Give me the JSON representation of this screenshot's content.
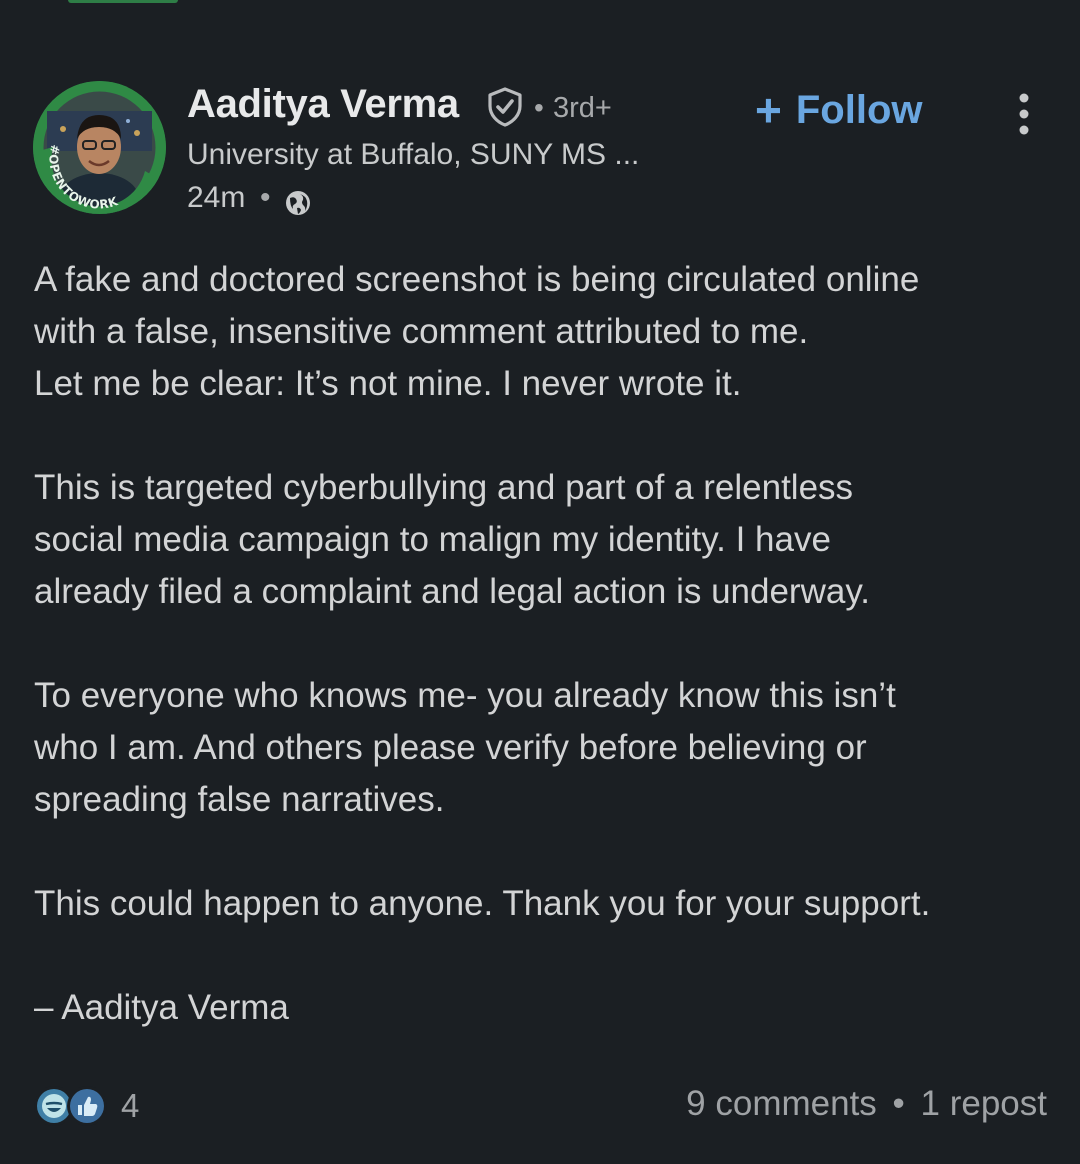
{
  "post": {
    "author": {
      "name": "Aaditya Verma",
      "degree_separator": "•",
      "degree": "3rd+",
      "headline": "University at Buffalo, SUNY MS ...",
      "avatar_badge_text": "#OPENTOWORK"
    },
    "meta": {
      "time": "24m",
      "separator": "•",
      "visibility_icon": "globe-icon"
    },
    "follow_button": {
      "plus": "+",
      "label": "Follow"
    },
    "body": {
      "paragraphs": [
        {
          "lines": [
            "A fake and doctored screenshot is being circulated online",
            "with a false, insensitive comment attributed to me.",
            "Let me be clear: It’s not mine. I never wrote it."
          ]
        },
        {
          "lines": [
            "This is targeted cyberbullying and part of a relentless",
            "social media campaign to malign my identity. I have",
            "already filed a complaint and legal action is underway."
          ]
        },
        {
          "lines": [
            "To everyone who knows me- you already know this isn’t",
            "who I am. And others please verify before believing or",
            "spreading false narratives."
          ]
        },
        {
          "lines": [
            "This could happen to anyone. Thank you for your support."
          ]
        },
        {
          "lines": [
            "– Aaditya Verma"
          ]
        }
      ]
    },
    "social": {
      "reaction_icons": [
        "funny-reaction-icon",
        "like-reaction-icon"
      ],
      "reaction_count": "4",
      "comments": "9 comments",
      "separator": "•",
      "reposts": "1 repost"
    },
    "colors": {
      "background": "#1b1f23",
      "link_blue": "#6aa6e0",
      "open_to_work_green": "#2f8a45"
    }
  }
}
